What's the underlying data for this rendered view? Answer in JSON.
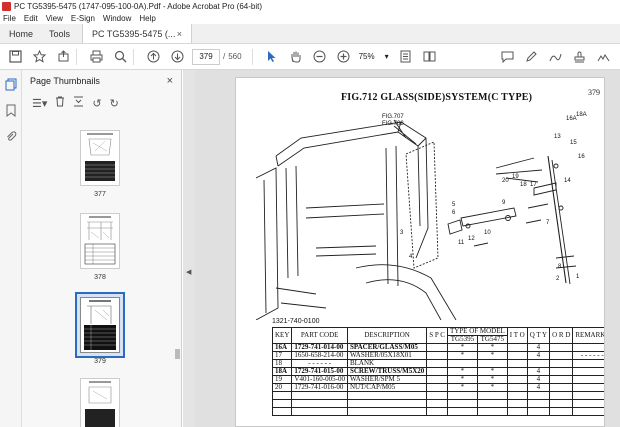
{
  "window": {
    "title": "PC TG5395-5475 (1747-095-100-0A).Pdf - Adobe Acrobat Pro (64-bit)"
  },
  "menu": [
    "File",
    "Edit",
    "View",
    "E-Sign",
    "Window",
    "Help"
  ],
  "tabs": {
    "home": "Home",
    "tools": "Tools",
    "document": "PC TG5395-5475 (...",
    "close": "×"
  },
  "toolbar": {
    "current_page": "379",
    "separator": "/",
    "total_pages": "560",
    "zoom": "75%"
  },
  "panel": {
    "title": "Page Thumbnails",
    "close": "×",
    "thumbnails": [
      {
        "label": "377"
      },
      {
        "label": "378"
      },
      {
        "label": "379",
        "selected": true
      }
    ]
  },
  "page": {
    "page_number": "379",
    "figure_title": "FIG.712  GLASS(SIDE)SYSTEM(C TYPE)",
    "drawing_id": "1321-740-0100",
    "callouts": [
      "FIG.707",
      "FIG.708",
      "16A",
      "18A",
      "13",
      "15",
      "16",
      "20",
      "19",
      "18",
      "17",
      "14",
      "5",
      "6",
      "12",
      "11",
      "10",
      "9",
      "7",
      "8",
      "4",
      "2",
      "1",
      "3"
    ],
    "table": {
      "headers": {
        "key": "KEY",
        "part_code": "PART CODE",
        "description": "DESCRIPTION",
        "spc": "S P C",
        "type_of_model": "TYPE OF MODEL",
        "model_a": "TG5395",
        "model_b": "TG5475",
        "i": "I T O",
        "q": "Q T Y",
        "r": "O R D",
        "remarks": "REMARKS"
      },
      "rows": [
        {
          "key": "16A",
          "code": "1729-741-014-00",
          "desc": "SPACER/GLASS/M05",
          "a": "*",
          "b": "*",
          "qty": "4",
          "remarks": ""
        },
        {
          "key": "17",
          "code": "1650-658-214-00",
          "desc": "WASHER/05X18X01",
          "a": "*",
          "b": "*",
          "qty": "4",
          "remarks": "- - - - - -"
        },
        {
          "key": "18",
          "code": "- - - - - -",
          "desc": "BLANK",
          "a": "",
          "b": "",
          "qty": "",
          "remarks": ""
        },
        {
          "key": "18A",
          "code": "1729-741-015-00",
          "desc": "SCREW/TRUSS/M5X20",
          "a": "*",
          "b": "*",
          "qty": "4",
          "remarks": ""
        },
        {
          "key": "19",
          "code": "V401-160-005-00",
          "desc": "WASHER/SPM 5",
          "a": "*",
          "b": "*",
          "qty": "4",
          "remarks": ""
        },
        {
          "key": "20",
          "code": "1729-741-016-00",
          "desc": "NUT/CAP/M05",
          "a": "*",
          "b": "*",
          "qty": "4",
          "remarks": ""
        }
      ]
    }
  }
}
